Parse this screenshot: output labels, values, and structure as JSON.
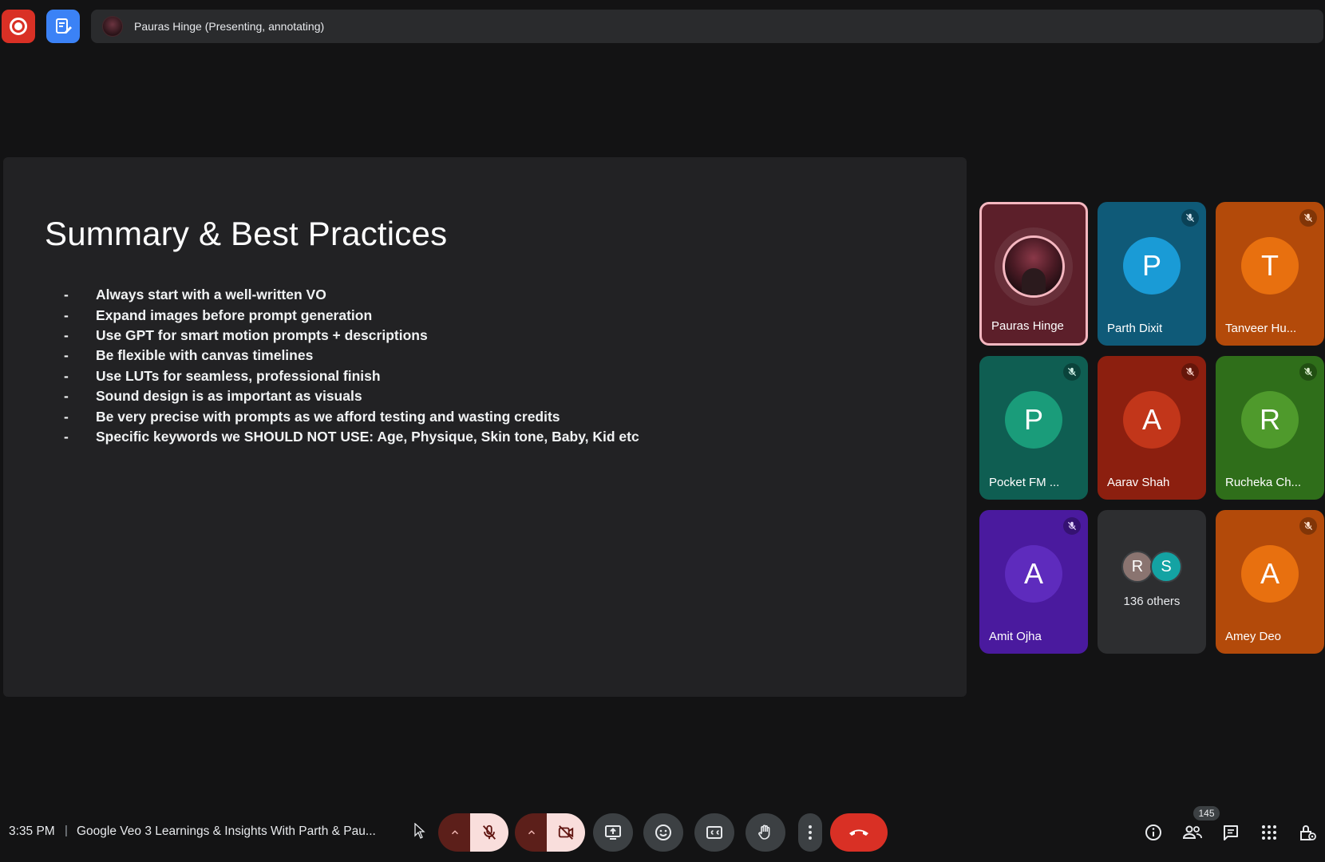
{
  "presenter_bar": {
    "text": "Pauras Hinge (Presenting, annotating)"
  },
  "slide": {
    "title": "Summary & Best Practices",
    "bullet_marker": "-",
    "bullets": [
      "Always start with a well-written VO",
      "Expand images before prompt generation",
      "Use GPT for smart motion prompts + descriptions",
      "Be flexible with canvas timelines",
      "Use LUTs for seamless, professional finish",
      "Sound design is as important as visuals",
      "Be very precise with prompts as we afford testing and wasting credits",
      "Specific keywords we SHOULD NOT USE: Age, Physique, Skin tone, Baby, Kid etc"
    ]
  },
  "participants": [
    {
      "name": "Pauras Hinge",
      "initial": "",
      "muted": false,
      "presenting": true,
      "bg": "#5c1f2a",
      "avatar_color": "#3a1c22"
    },
    {
      "name": "Parth Dixit",
      "initial": "P",
      "muted": true,
      "bg": "#0f5a78",
      "avatar_color": "#1a9bd6"
    },
    {
      "name": "Tanveer Hu...",
      "initial": "T",
      "muted": true,
      "bg": "#b34a0a",
      "avatar_color": "#e8700f"
    },
    {
      "name": "Pocket FM ...",
      "initial": "P",
      "muted": true,
      "bg": "#0f5e52",
      "avatar_color": "#1a9c7a"
    },
    {
      "name": "Aarav Shah",
      "initial": "A",
      "muted": true,
      "bg": "#8c1f0f",
      "avatar_color": "#c2361a"
    },
    {
      "name": "Rucheka Ch...",
      "initial": "R",
      "muted": true,
      "bg": "#2f6e1a",
      "avatar_color": "#4f9a2c"
    },
    {
      "name": "Amit Ojha",
      "initial": "A",
      "muted": true,
      "bg": "#4a1a9e",
      "avatar_color": "#5e2bbd"
    },
    {
      "name": "Amey Deo",
      "initial": "A",
      "muted": true,
      "bg": "#b34a0a",
      "avatar_color": "#e8700f"
    }
  ],
  "others": {
    "avatars": [
      {
        "initial": "R",
        "color": "#8a7470"
      },
      {
        "initial": "S",
        "color": "#14a3a3"
      }
    ],
    "label": "136 others"
  },
  "bottom_bar": {
    "time": "3:35 PM",
    "separator": "|",
    "meeting_title": "Google Veo 3 Learnings & Insights With Parth & Pau...",
    "people_count": "145"
  },
  "icons": {
    "record": "record-icon",
    "notes": "notes-icon",
    "mic_off": "mic-off-icon",
    "camera_off": "camera-off-icon",
    "present": "present-screen-icon",
    "emoji": "emoji-icon",
    "captions": "captions-icon",
    "raise_hand": "raise-hand-icon",
    "more": "more-vert-icon",
    "end_call": "end-call-icon",
    "info": "info-icon",
    "people": "people-icon",
    "chat": "chat-icon",
    "activities": "apps-grid-icon",
    "host_controls": "host-controls-icon"
  }
}
